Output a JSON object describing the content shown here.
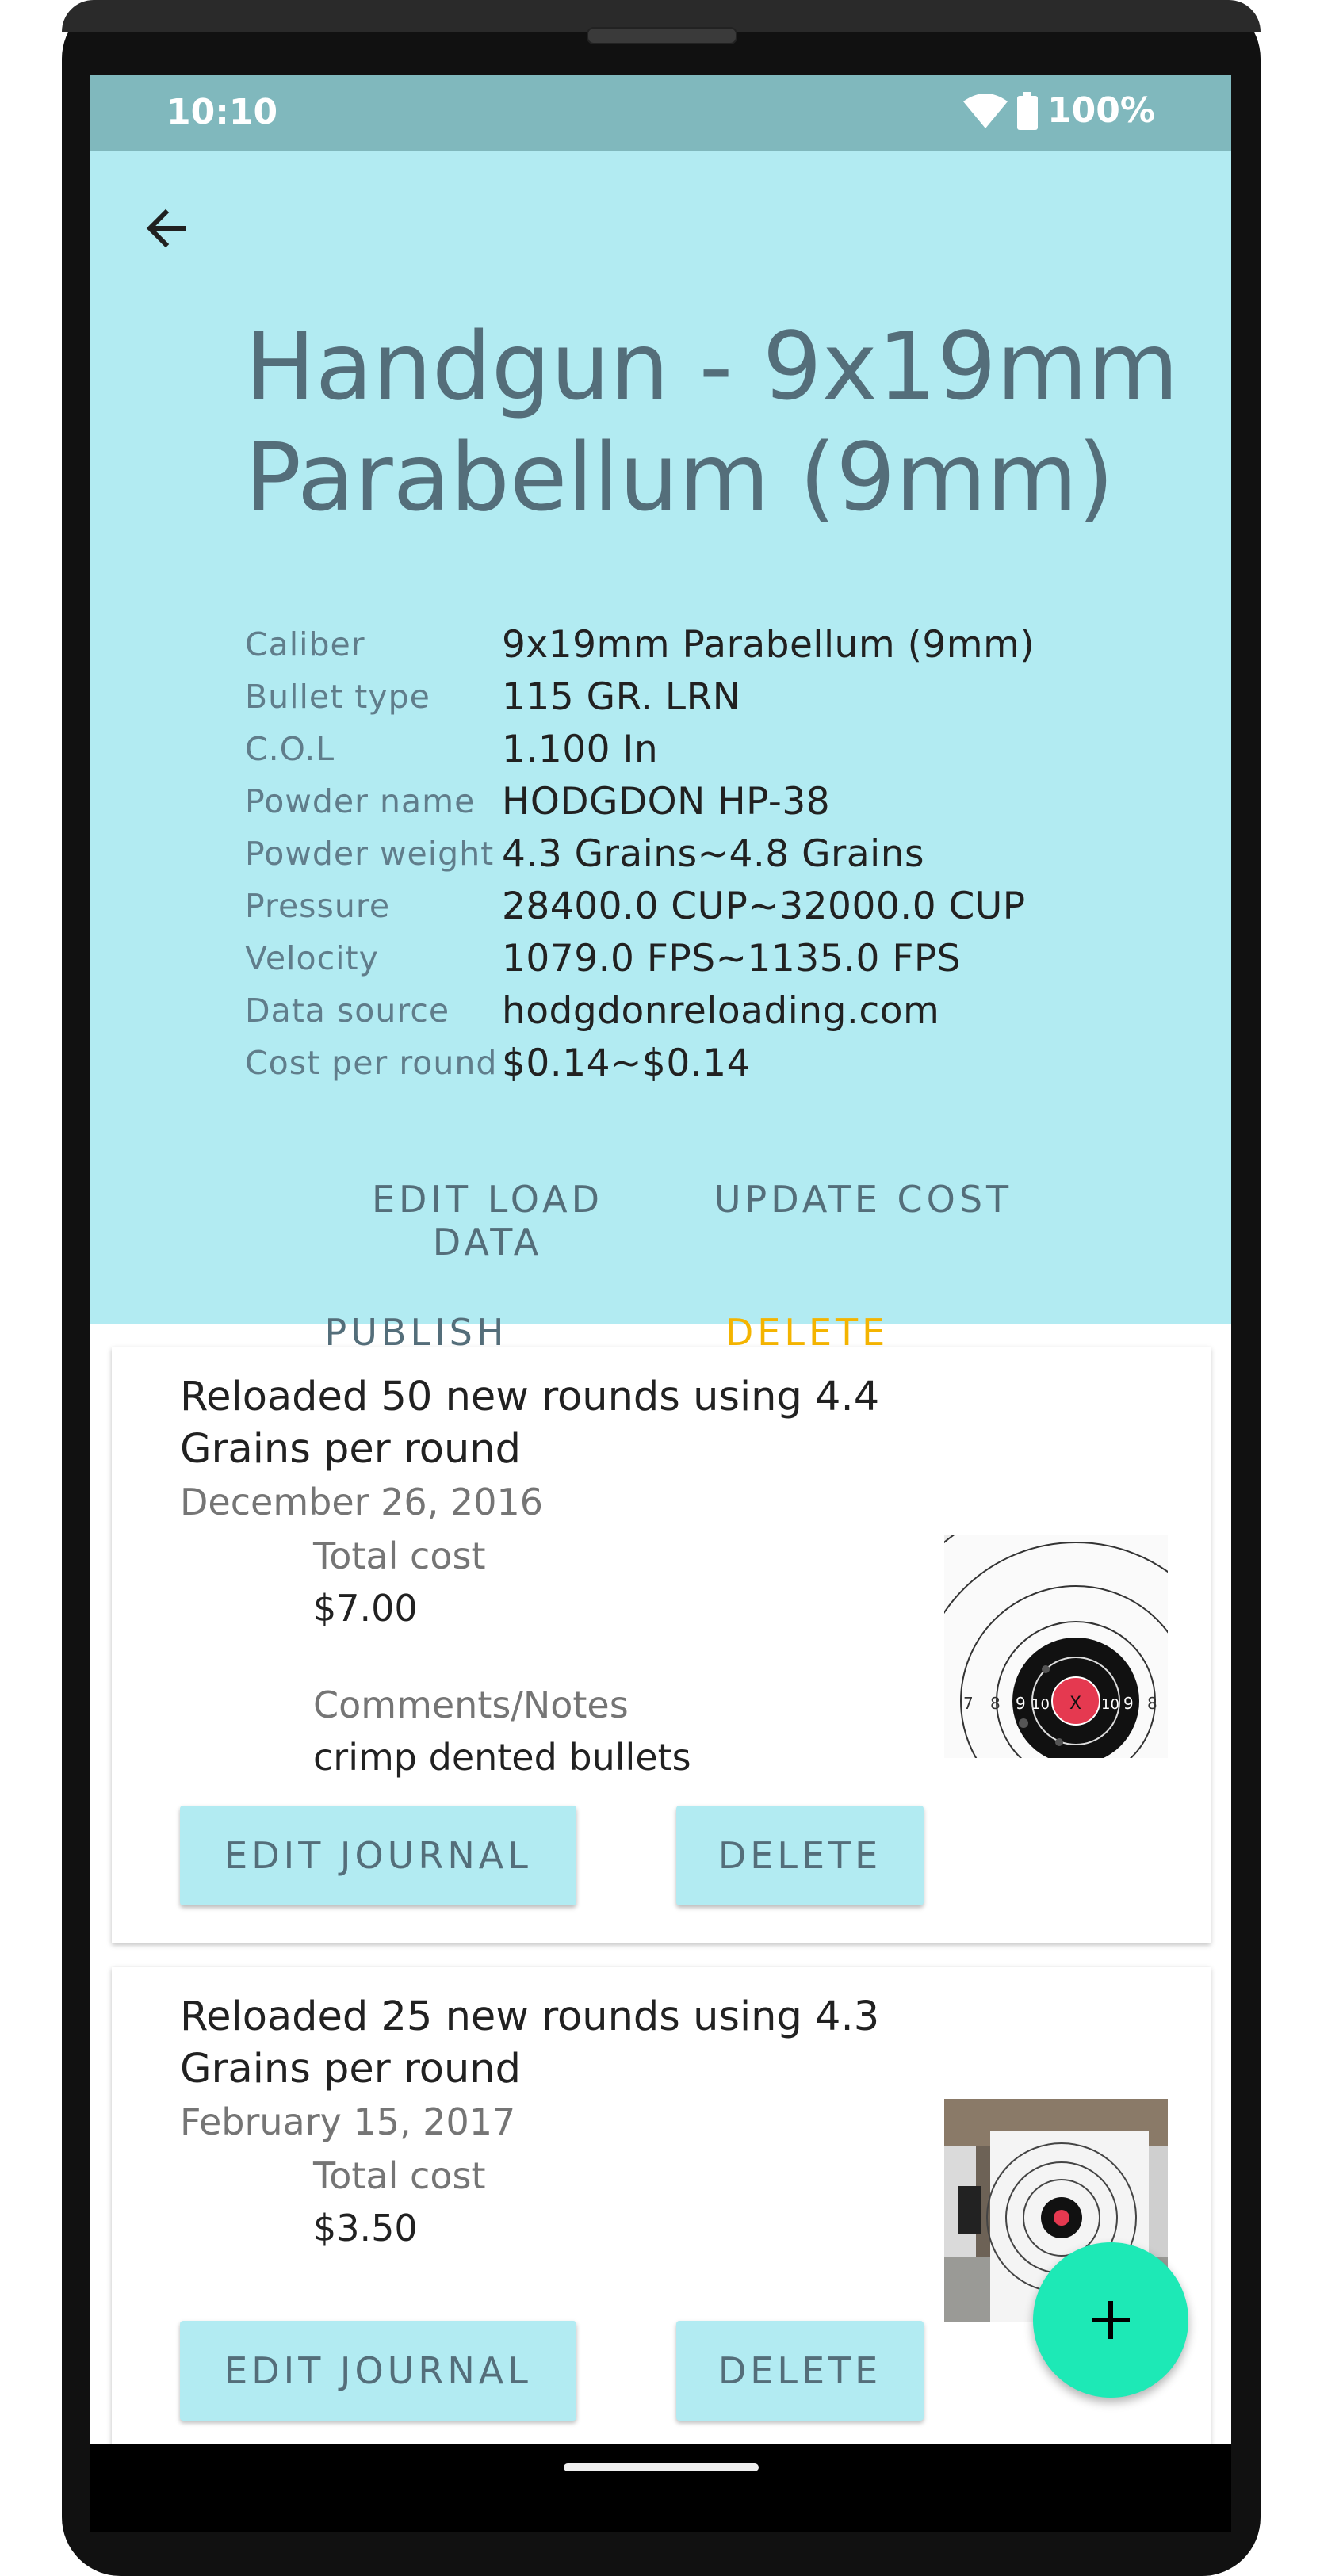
{
  "status": {
    "time": "10:10",
    "battery": "100%"
  },
  "load": {
    "title": "Handgun - 9x19mm Parabellum (9mm)",
    "specs": [
      {
        "label": "Caliber",
        "value": "9x19mm Parabellum (9mm)"
      },
      {
        "label": "Bullet type",
        "value": "115 GR. LRN"
      },
      {
        "label": "C.O.L",
        "value": "1.100 In"
      },
      {
        "label": "Powder name",
        "value": "HODGDON HP-38"
      },
      {
        "label": "Powder weight",
        "value": "4.3 Grains~4.8 Grains"
      },
      {
        "label": "Pressure",
        "value": "28400.0 CUP~32000.0 CUP"
      },
      {
        "label": "Velocity",
        "value": "1079.0 FPS~1135.0 FPS"
      },
      {
        "label": "Data source",
        "value": "hodgdonreloading.com"
      },
      {
        "label": "Cost per round",
        "value": "$0.14~$0.14"
      }
    ],
    "actions": {
      "edit_load_data": "EDIT LOAD DATA",
      "update_cost": "UPDATE COST",
      "publish": "PUBLISH",
      "delete": "DELETE"
    }
  },
  "journals": [
    {
      "title": "Reloaded 50 new rounds using 4.4 Grains per round",
      "date": "December 26, 2016",
      "total_cost_label": "Total cost",
      "total_cost": "$7.00",
      "notes_label": "Comments/Notes",
      "notes": "crimp dented bullets",
      "edit_label": "EDIT JOURNAL",
      "delete_label": "DELETE"
    },
    {
      "title": "Reloaded 25 new rounds using 4.3 Grains per round",
      "date": "February 15, 2017",
      "total_cost_label": "Total cost",
      "total_cost": "$3.50",
      "edit_label": "EDIT JOURNAL",
      "delete_label": "DELETE"
    }
  ],
  "target_numbers": [
    "7",
    "8",
    "9",
    "10",
    "X",
    "10",
    "9",
    "8"
  ],
  "colors": {
    "header_bg": "#b2ebf2",
    "status_bar": "#80b8bd",
    "delete_accent": "#f4b400",
    "fab": "#1de9b6"
  },
  "icons": {
    "back": "arrow-back-icon",
    "wifi": "wifi-icon",
    "battery": "battery-icon",
    "fab": "plus-icon"
  }
}
